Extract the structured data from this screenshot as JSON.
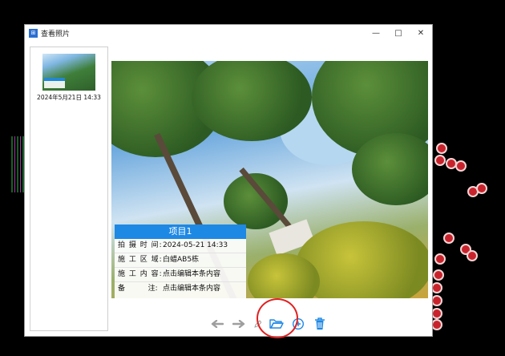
{
  "window": {
    "title": "查看照片",
    "app_icon_text": "⊞",
    "controls": {
      "minimize": "—",
      "maximize": "□",
      "close": "✕"
    }
  },
  "sidebar": {
    "items": [
      {
        "caption": "2024年5月21日 14:33"
      }
    ]
  },
  "photo": {
    "info_box": {
      "title": "项目1",
      "rows": [
        {
          "key": "拍 摄 时 间:",
          "value": "2024-05-21 14:33"
        },
        {
          "key": "施 工 区 域:",
          "value": "白蜡AB5栋"
        },
        {
          "key": "施 工 内 容:",
          "value": "点击编辑本条内容"
        },
        {
          "key": "备          注:",
          "value": "点击编辑本条内容"
        }
      ]
    }
  },
  "toolbar": {
    "buttons": [
      {
        "icon": "arrow-left-icon"
      },
      {
        "icon": "arrow-right-icon"
      },
      {
        "icon": "edit-icon"
      },
      {
        "icon": "folder-open-icon"
      },
      {
        "icon": "add-icon"
      },
      {
        "icon": "trash-icon"
      }
    ],
    "accent_color": "#1e88e5",
    "disabled_color": "#9e9e9e"
  }
}
